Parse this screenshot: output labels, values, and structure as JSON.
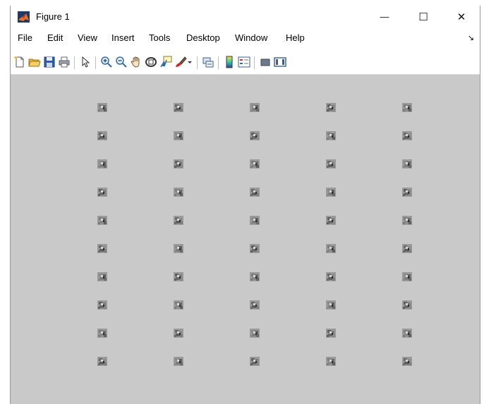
{
  "window": {
    "title": "Figure 1",
    "minimize_glyph": "—",
    "maximize_glyph": "☐",
    "close_glyph": "✕"
  },
  "menubar": {
    "items": [
      "File",
      "Edit",
      "View",
      "Insert",
      "Tools",
      "Desktop",
      "Window",
      "Help"
    ],
    "dock_glyph": "↘"
  },
  "toolbar": {
    "icons": [
      "new-figure-icon",
      "open-file-icon",
      "save-icon",
      "print-icon",
      "edit-plot-arrow-icon",
      "zoom-in-icon",
      "zoom-out-icon",
      "pan-hand-icon",
      "rotate-3d-icon",
      "data-cursor-icon",
      "brush-icon",
      "brush-dropdown-icon",
      "link-plot-icon",
      "insert-colorbar-icon",
      "insert-legend-icon",
      "hide-plot-tools-icon",
      "show-plot-tools-icon"
    ]
  },
  "figure": {
    "rows": 10,
    "cols": 5,
    "thumbnail_icon": "image-thumbnail-icon",
    "background_color": "#c9c9c9"
  }
}
